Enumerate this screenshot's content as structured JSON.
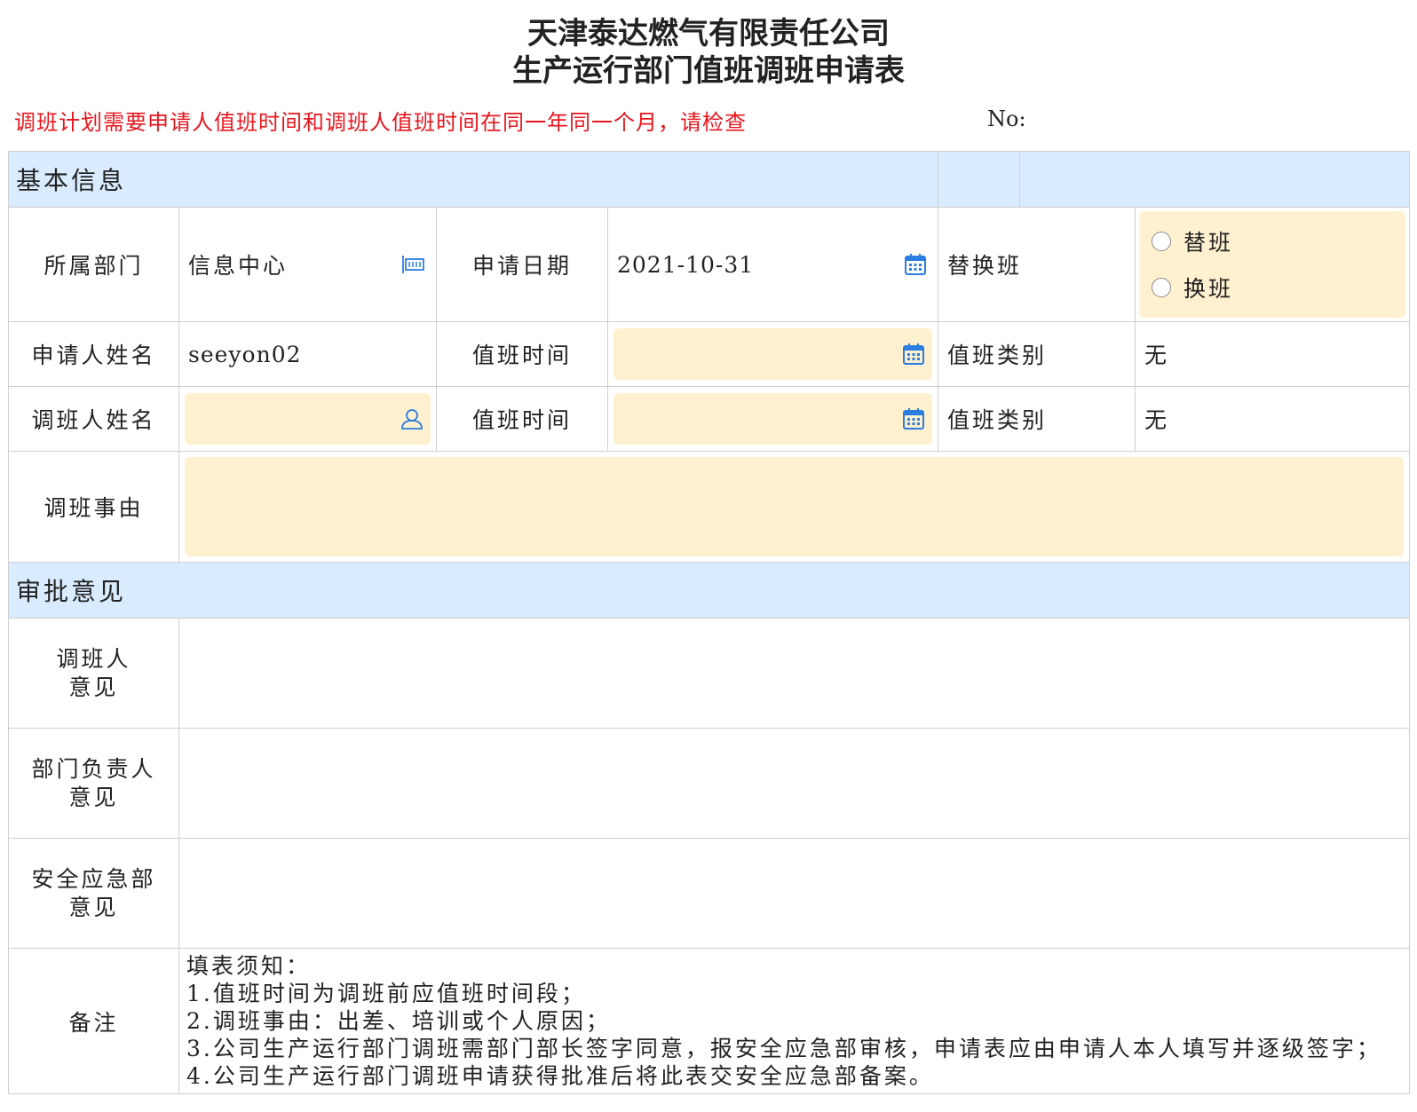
{
  "header": {
    "company": "天津泰达燃气有限责任公司",
    "form_title": "生产运行部门值班调班申请表",
    "warning": "调班计划需要申请人值班时间和调班人值班时间在同一年同一个月，请检查",
    "no_label": "No:"
  },
  "basic_section": {
    "title": "基本信息"
  },
  "department": {
    "label": "所属部门",
    "value": "信息中心",
    "icon": "department-select-icon"
  },
  "apply_date": {
    "label": "申请日期",
    "value": "2021-10-31",
    "icon": "calendar-icon"
  },
  "swap_type": {
    "label": "替换班",
    "options": [
      "替班",
      "换班"
    ]
  },
  "applicant": {
    "label": "申请人姓名",
    "value": "seeyon02",
    "duty_time_label": "值班时间",
    "duty_time_value": "",
    "duty_type_label": "值班类别",
    "duty_type_value": "无"
  },
  "swapper": {
    "label": "调班人姓名",
    "value": "",
    "icon": "person-icon",
    "duty_time_label": "值班时间",
    "duty_time_value": "",
    "duty_type_label": "值班类别",
    "duty_type_value": "无"
  },
  "reason": {
    "label": "调班事由",
    "value": ""
  },
  "approval_section": {
    "title": "审批意见"
  },
  "approvals": [
    {
      "label_line1": "调班人",
      "label_line2": "意见"
    },
    {
      "label_line1": "部门负责人",
      "label_line2": "意见"
    },
    {
      "label_line1": "安全应急部",
      "label_line2": "意见"
    }
  ],
  "remarks": {
    "label": "备注",
    "lines": [
      "填表须知：",
      "1.值班时间为调班前应值班时间段；",
      "2.调班事由：出差、培训或个人原因；",
      "3.公司生产运行部门调班需部门部长签字同意，报安全应急部审核，申请表应由申请人本人填写并逐级签字；",
      "4.公司生产运行部门调班申请获得批准后将此表交安全应急部备案。"
    ]
  },
  "colors": {
    "section_bg": "#d9ebff",
    "input_bg": "#fff0cf",
    "warning": "#e8161e",
    "icon_blue": "#2a7de1"
  }
}
